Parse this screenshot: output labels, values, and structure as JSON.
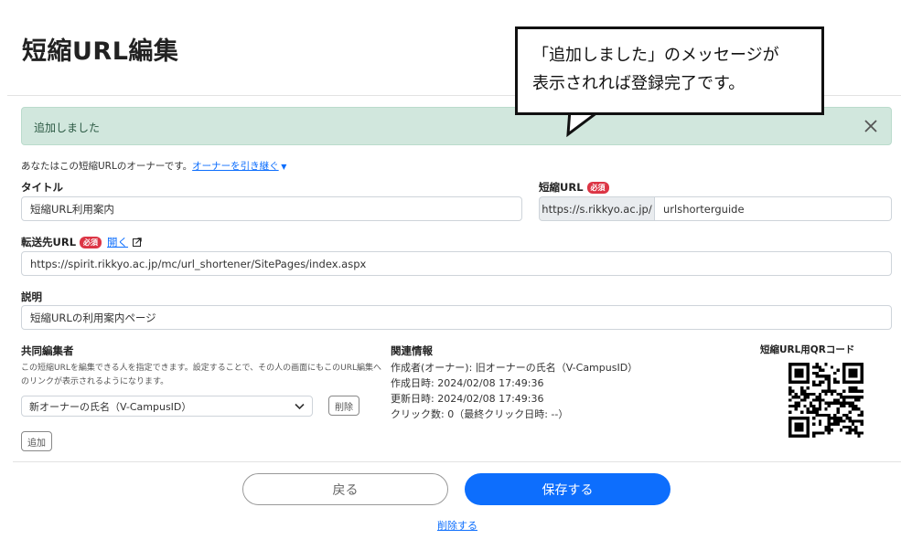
{
  "page": {
    "title": "短縮URL編集"
  },
  "alert": {
    "message": "追加しました",
    "close_icon": "close-icon",
    "color": "#d1e7dd"
  },
  "callout": {
    "line1": "「追加しました」のメッセージが",
    "line2": "表示されれば登録完了です。"
  },
  "owner": {
    "text": "あなたはこの短縮URLのオーナーです。",
    "link": "オーナーを引き継ぐ"
  },
  "form": {
    "title_label": "タイトル",
    "title_value": "短縮URL利用案内",
    "short_url_label": "短縮URL",
    "required_badge": "必須",
    "short_url_prefix": "https://s.rikkyo.ac.jp/",
    "short_url_value": "urlshorterguide",
    "dest_label": "転送先URL",
    "dest_open_link": "開く",
    "dest_value": "https://spirit.rikkyo.ac.jp/mc/url_shortener/SitePages/index.aspx",
    "desc_label": "説明",
    "desc_value": "短縮URLの利用案内ページ"
  },
  "coeditors": {
    "label": "共同編集者",
    "note_line1": "この短縮URLを編集できる人を指定できます。設定することで、その人の画面にもこのURL編集へ",
    "note_line2": "のリンクが表示されるようになります。",
    "selected": "新オーナーの氏名（V-CampusID）",
    "remove_label": "削除",
    "add_label": "追加"
  },
  "related": {
    "label": "関連情報",
    "creator": "作成者(オーナー): 旧オーナーの氏名（V-CampusID）",
    "created": "作成日時: 2024/02/08 17:49:36",
    "updated": "更新日時: 2024/02/08 17:49:36",
    "clicks": "クリック数: 0（最終クリック日時: --）"
  },
  "qr": {
    "label": "短縮URL用QRコード"
  },
  "actions": {
    "back_label": "戻る",
    "save_label": "保存する",
    "delete_label": "削除する",
    "save_color": "#0d6efd"
  }
}
